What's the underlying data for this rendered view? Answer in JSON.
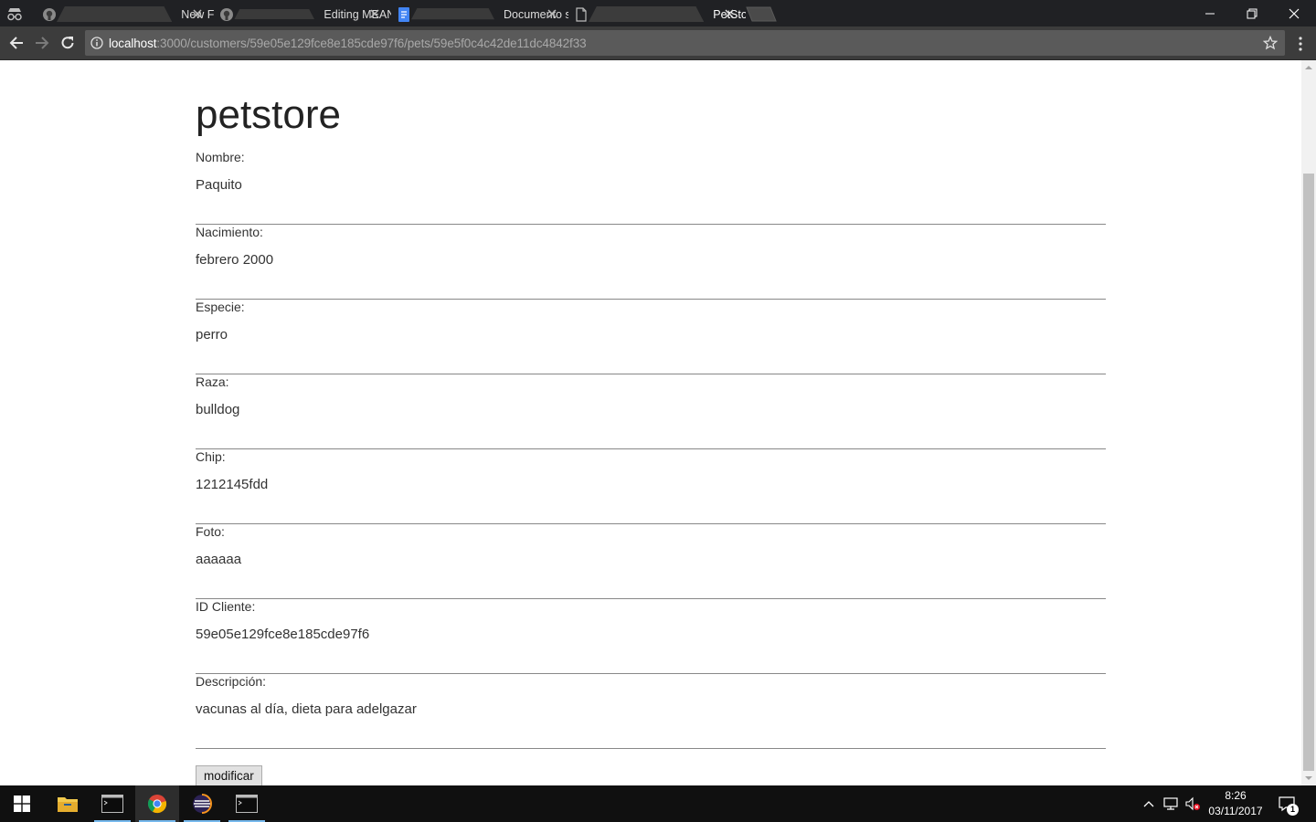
{
  "browser": {
    "tabs": [
      {
        "title": "New File",
        "favicon": "github-icon",
        "active": false
      },
      {
        "title": "Editing MEAN-PetStore/R",
        "favicon": "github-icon",
        "active": false
      },
      {
        "title": "Documento sin título - D",
        "favicon": "google-docs-icon",
        "active": false
      },
      {
        "title": "PetStore",
        "favicon": "page-icon",
        "active": true
      }
    ],
    "url_host": "localhost",
    "url_path": ":3000/customers/59e05e129fce8e185cde97f6/pets/59e5f0c4c42de11dc4842f33"
  },
  "page": {
    "heading": "petstore",
    "fields": [
      {
        "label": "Nombre:",
        "value": "Paquito"
      },
      {
        "label": "Nacimiento:",
        "value": "febrero 2000"
      },
      {
        "label": "Especie:",
        "value": "perro"
      },
      {
        "label": "Raza:",
        "value": "bulldog"
      },
      {
        "label": "Chip:",
        "value": "1212145fdd"
      },
      {
        "label": "Foto:",
        "value": "aaaaaa"
      },
      {
        "label": "ID Cliente:",
        "value": "59e05e129fce8e185cde97f6"
      },
      {
        "label": "Descripción:",
        "value": "vacunas al día, dieta para adelgazar"
      }
    ],
    "submit_label": "modificar"
  },
  "taskbar": {
    "time": "8:26",
    "date": "03/11/2017",
    "notification_count": "1"
  },
  "colors": {
    "tabstrip": "#202124",
    "toolbar": "#3c3c3c",
    "omnibox": "#5a5a5a",
    "taskbar": "#101010",
    "taskbar_accent": "#76b9ed"
  }
}
